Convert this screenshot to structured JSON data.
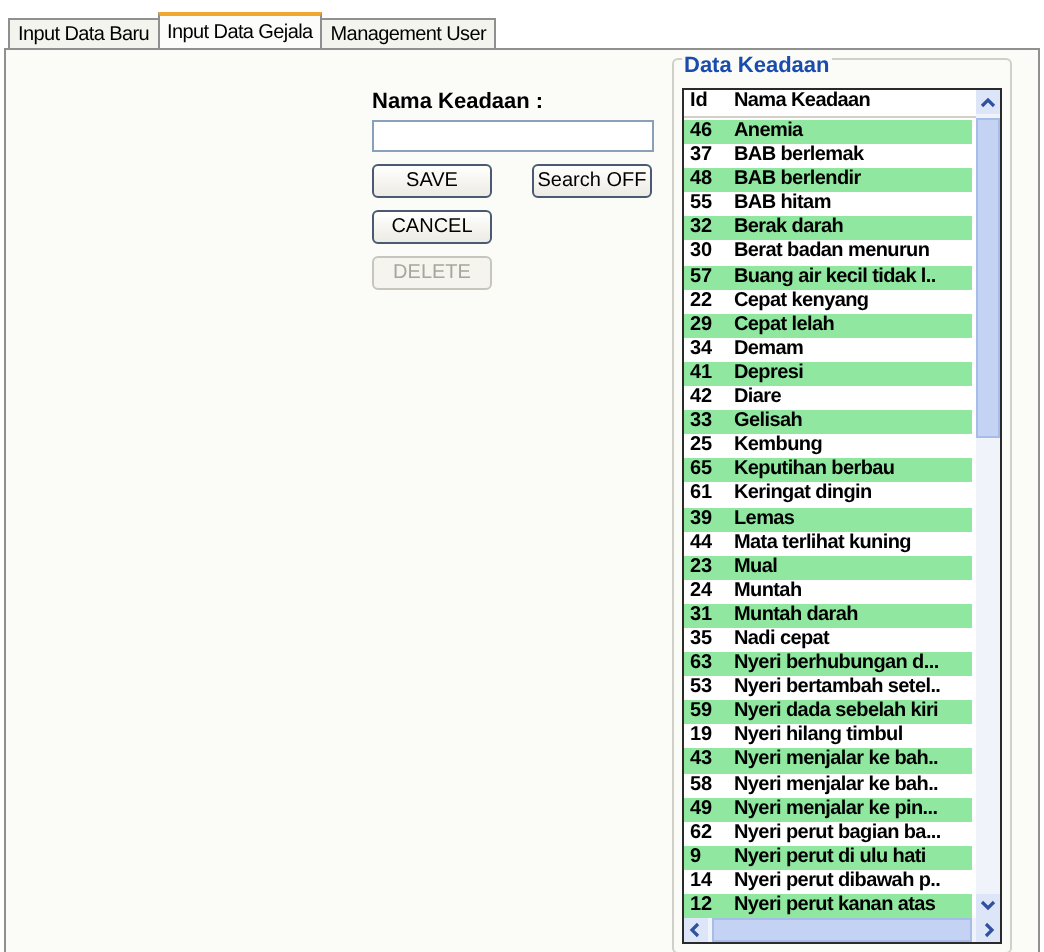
{
  "tabs": [
    {
      "label": "Input Data Baru",
      "selected": false
    },
    {
      "label": "Input Data Gejala",
      "selected": true
    },
    {
      "label": "Management User",
      "selected": false
    }
  ],
  "form": {
    "label": "Nama Keadaan :",
    "buttons": [
      {
        "label": "SAVE",
        "disabled": false
      },
      {
        "label": "Search OFF",
        "disabled": false
      },
      {
        "label": "CANCEL",
        "disabled": false
      },
      {
        "label": "DELETE",
        "disabled": true
      }
    ]
  },
  "data_keadaan": {
    "title": "Data Keadaan",
    "columns": [
      "Id",
      "Nama Keadaan"
    ],
    "rows": [
      [
        "46",
        "Anemia"
      ],
      [
        "37",
        "BAB berlemak"
      ],
      [
        "48",
        "BAB berlendir"
      ],
      [
        "55",
        "BAB hitam"
      ],
      [
        "32",
        "Berak darah"
      ],
      [
        "30",
        "Berat badan menurun"
      ],
      [
        "57",
        "Buang air kecil tidak l.."
      ],
      [
        "22",
        "Cepat kenyang"
      ],
      [
        "29",
        "Cepat lelah"
      ],
      [
        "34",
        "Demam"
      ],
      [
        "41",
        "Depresi"
      ],
      [
        "42",
        "Diare"
      ],
      [
        "33",
        "Gelisah"
      ],
      [
        "25",
        "Kembung"
      ],
      [
        "65",
        "Keputihan berbau"
      ],
      [
        "61",
        "Keringat dingin"
      ],
      [
        "39",
        "Lemas"
      ],
      [
        "44",
        "Mata terlihat kuning"
      ],
      [
        "23",
        "Mual"
      ],
      [
        "24",
        "Muntah"
      ],
      [
        "31",
        "Muntah darah"
      ],
      [
        "35",
        "Nadi cepat"
      ],
      [
        "63",
        "Nyeri berhubungan d..."
      ],
      [
        "53",
        "Nyeri bertambah setel.."
      ],
      [
        "59",
        "Nyeri dada sebelah kiri"
      ],
      [
        "19",
        "Nyeri hilang timbul"
      ],
      [
        "43",
        "Nyeri menjalar ke bah.."
      ],
      [
        "58",
        "Nyeri menjalar ke bah.."
      ],
      [
        "49",
        "Nyeri menjalar ke pin..."
      ],
      [
        "62",
        "Nyeri perut bagian ba..."
      ],
      [
        "9",
        "Nyeri perut di ulu hati"
      ],
      [
        "14",
        "Nyeri perut dibawah p.."
      ],
      [
        "12",
        "Nyeri perut kanan atas"
      ]
    ]
  }
}
